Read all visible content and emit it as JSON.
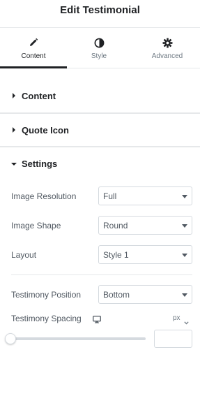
{
  "header": {
    "title": "Edit Testimonial"
  },
  "tabs": [
    {
      "label": "Content",
      "icon": "pencil-icon",
      "active": true
    },
    {
      "label": "Style",
      "icon": "half-circle-icon",
      "active": false
    },
    {
      "label": "Advanced",
      "icon": "gear-icon",
      "active": false
    }
  ],
  "sections": {
    "content": {
      "title": "Content",
      "expanded": false
    },
    "quote_icon": {
      "title": "Quote Icon",
      "expanded": false
    },
    "settings": {
      "title": "Settings",
      "expanded": true
    }
  },
  "controls": {
    "image_resolution": {
      "label": "Image Resolution",
      "value": "Full"
    },
    "image_shape": {
      "label": "Image Shape",
      "value": "Round"
    },
    "layout": {
      "label": "Layout",
      "value": "Style 1"
    },
    "testimony_position": {
      "label": "Testimony Position",
      "value": "Bottom"
    },
    "testimony_spacing": {
      "label": "Testimony Spacing",
      "unit": "px",
      "value": "",
      "slider_fraction": 0
    }
  },
  "colors": {
    "text_dark": "#1f2124",
    "text": "#515962",
    "border": "#d5dadf",
    "divider": "#e6e8ea"
  }
}
